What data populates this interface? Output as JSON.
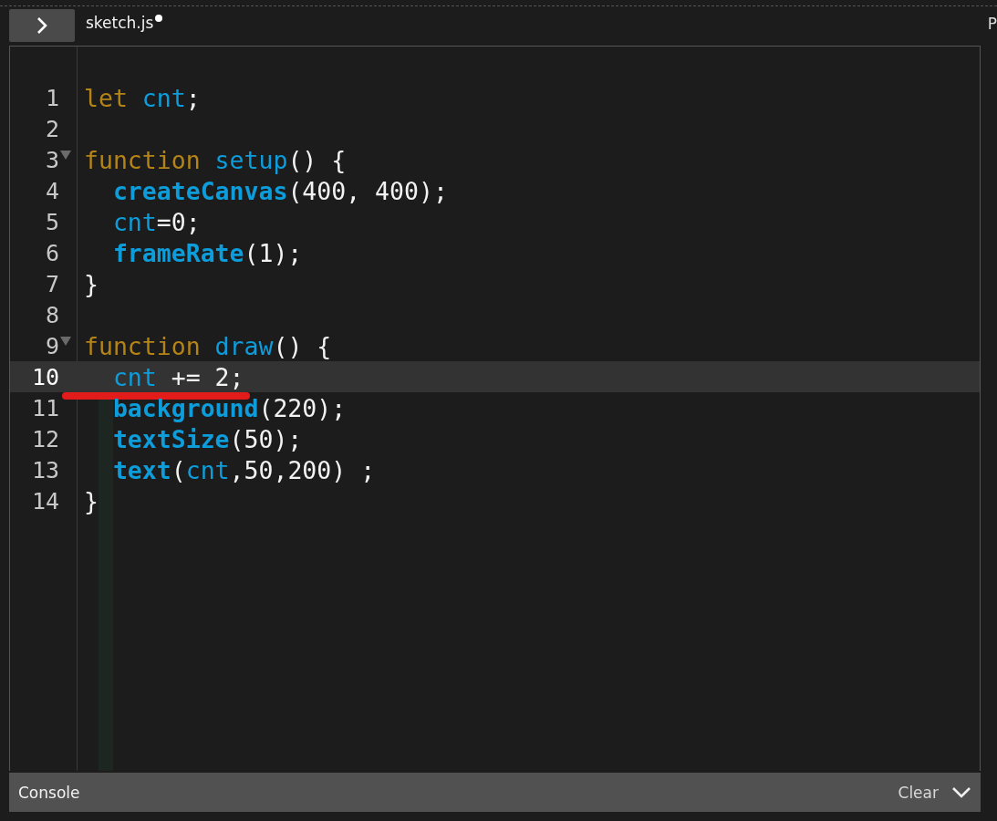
{
  "toolbar": {
    "file_name": "sketch.js",
    "unsaved": true,
    "edge_text": "P"
  },
  "editor": {
    "lines": [
      {
        "number": "1",
        "active": false,
        "tokens": [
          {
            "kind": "keyword",
            "text": "let "
          },
          {
            "kind": "variable",
            "text": "cnt"
          },
          {
            "kind": "plain",
            "text": ";"
          }
        ]
      },
      {
        "number": "2",
        "active": false
      },
      {
        "number": "3",
        "active": false,
        "fold": true,
        "tokens": [
          {
            "kind": "keyword",
            "text": "function "
          },
          {
            "kind": "variable",
            "text": "setup"
          },
          {
            "kind": "plain",
            "text": "() {"
          }
        ]
      },
      {
        "number": "4",
        "active": false,
        "tokens": [
          {
            "kind": "builtin",
            "text": "  createCanvas"
          },
          {
            "kind": "plain",
            "text": "(400, 400);"
          }
        ]
      },
      {
        "number": "5",
        "active": false,
        "tokens": [
          {
            "kind": "variable",
            "text": "  cnt"
          },
          {
            "kind": "plain",
            "text": "=0;"
          }
        ]
      },
      {
        "number": "6",
        "active": false,
        "tokens": [
          {
            "kind": "builtin",
            "text": "  frameRate"
          },
          {
            "kind": "plain",
            "text": "(1);"
          }
        ]
      },
      {
        "number": "7",
        "active": false,
        "tokens": [
          {
            "kind": "plain",
            "text": "}"
          }
        ]
      },
      {
        "number": "8",
        "active": false
      },
      {
        "number": "9",
        "active": false,
        "fold": true,
        "tokens": [
          {
            "kind": "keyword",
            "text": "function "
          },
          {
            "kind": "variable",
            "text": "draw"
          },
          {
            "kind": "plain",
            "text": "() {"
          }
        ]
      },
      {
        "number": "10",
        "active": true,
        "underlined": true,
        "tokens": [
          {
            "kind": "variable",
            "text": "  cnt"
          },
          {
            "kind": "plain",
            "text": " += 2;"
          }
        ]
      },
      {
        "number": "11",
        "active": false,
        "tokens": [
          {
            "kind": "builtin",
            "text": "  background"
          },
          {
            "kind": "plain",
            "text": "(220);"
          }
        ]
      },
      {
        "number": "12",
        "active": false,
        "tokens": [
          {
            "kind": "builtin",
            "text": "  textSize"
          },
          {
            "kind": "plain",
            "text": "(50);"
          }
        ]
      },
      {
        "number": "13",
        "active": false,
        "tokens": [
          {
            "kind": "builtin",
            "text": "  text"
          },
          {
            "kind": "plain",
            "text": "("
          },
          {
            "kind": "variable",
            "text": "cnt"
          },
          {
            "kind": "plain",
            "text": ",50,200) ;"
          }
        ]
      },
      {
        "number": "14",
        "active": false,
        "tokens": [
          {
            "kind": "plain",
            "text": "}"
          }
        ]
      }
    ]
  },
  "console": {
    "title": "Console",
    "clear_label": "Clear"
  }
}
